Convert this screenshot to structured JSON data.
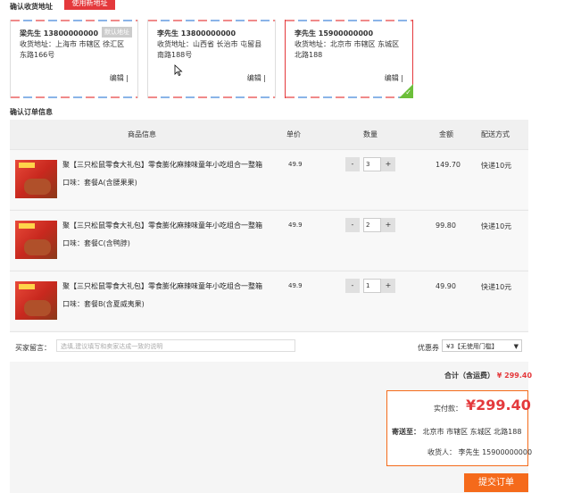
{
  "address_section": {
    "title": "确认收货地址",
    "new_address_button": "使用新地址",
    "cards": [
      {
        "name": "梁先生 13800000000",
        "default_badge": "默认地址",
        "address": "收货地址：上海市 市辖区 徐汇区 东路166号",
        "edit": "编辑",
        "selected": false
      },
      {
        "name": "李先生 13800000000",
        "default_badge": "",
        "address": "收货地址：山西省 长治市 屯留县 南路188号",
        "edit": "编辑",
        "selected": false
      },
      {
        "name": "李先生 15900000000",
        "default_badge": "",
        "address": "收货地址：北京市 市辖区 东城区 北路188",
        "edit": "编辑",
        "selected": true
      }
    ]
  },
  "order_section": {
    "title": "确认订单信息",
    "headers": {
      "product": "商品信息",
      "price": "单价",
      "qty": "数量",
      "amount": "金额",
      "shipping": "配送方式"
    },
    "items": [
      {
        "title": "聚【三只松鼠零食大礼包】零食膨化麻辣味童年小吃组合一整箱",
        "flavor": "口味：套餐A(含腰果果)",
        "price": "49.9",
        "qty": "3",
        "amount": "149.70",
        "shipping": "快递10元"
      },
      {
        "title": "聚【三只松鼠零食大礼包】零食膨化麻辣味童年小吃组合一整箱",
        "flavor": "口味：套餐C(含鸭脖)",
        "price": "49.9",
        "qty": "2",
        "amount": "99.80",
        "shipping": "快递10元"
      },
      {
        "title": "聚【三只松鼠零食大礼包】零食膨化麻辣味童年小吃组合一整箱",
        "flavor": "口味：套餐B(含夏威夷果)",
        "price": "49.9",
        "qty": "1",
        "amount": "49.90",
        "shipping": "快递10元"
      }
    ],
    "minus": "-",
    "plus": "+",
    "note_label": "买家留言：",
    "note_placeholder": "选填,建议填写和卖家达成一致的说明",
    "coupon_label": "优惠券",
    "coupon_value": "¥3【无使用门槛】",
    "total_label": "合计（含运费）",
    "total_value": "¥ 299.40"
  },
  "summary": {
    "due_label": "实付款：",
    "due_value": "¥299.40",
    "ship_to_label": "寄送至：",
    "ship_to_value": "北京市 市辖区 东城区 北路188",
    "receiver_label": "收货人：",
    "receiver_value": "李先生 15900000000"
  },
  "submit_button": "提交订单",
  "colors": {
    "accent": "#e4393c",
    "submit": "#f56a1b",
    "check": "#6cbf3a"
  }
}
